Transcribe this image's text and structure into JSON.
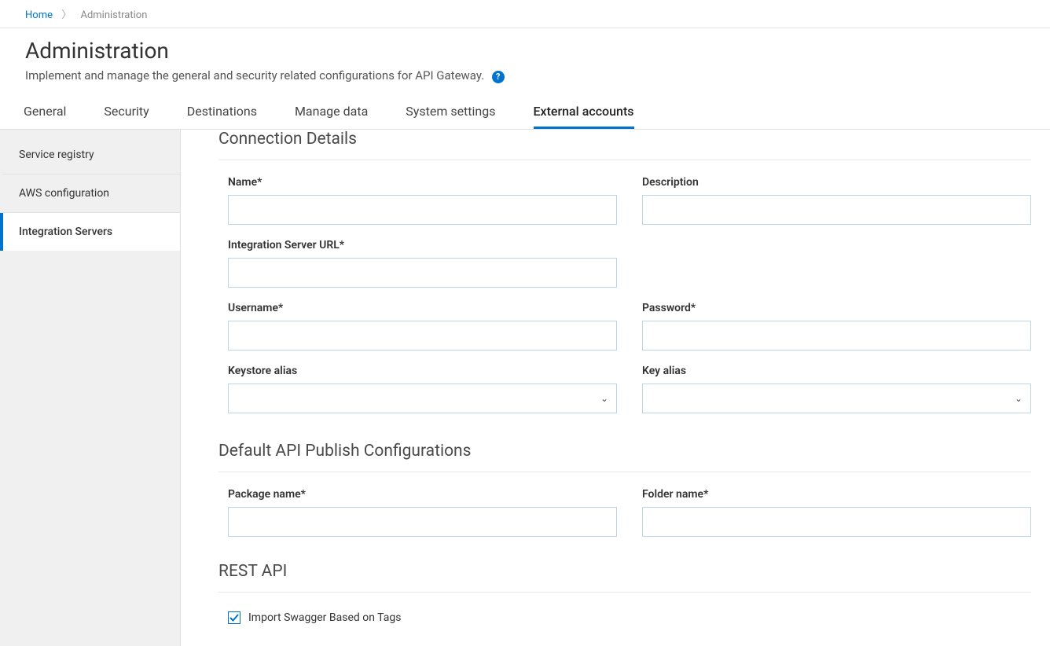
{
  "breadcrumb": {
    "home": "Home",
    "current": "Administration"
  },
  "header": {
    "title": "Administration",
    "subtitle": "Implement and manage the general and security related configurations for API Gateway.",
    "help": "?"
  },
  "tabs": {
    "items": [
      {
        "label": "General"
      },
      {
        "label": "Security"
      },
      {
        "label": "Destinations"
      },
      {
        "label": "Manage data"
      },
      {
        "label": "System settings"
      },
      {
        "label": "External accounts"
      }
    ],
    "activeIndex": 5
  },
  "sidebar": {
    "items": [
      {
        "label": "Service registry"
      },
      {
        "label": "AWS configuration"
      },
      {
        "label": "Integration Servers"
      }
    ],
    "activeIndex": 2
  },
  "sections": {
    "connection": {
      "title": "Connection Details",
      "fields": {
        "name": {
          "label": "Name*",
          "value": ""
        },
        "description": {
          "label": "Description",
          "value": ""
        },
        "isUrl": {
          "label": "Integration Server URL*",
          "value": ""
        },
        "username": {
          "label": "Username*",
          "value": ""
        },
        "password": {
          "label": "Password*",
          "value": ""
        },
        "keystore": {
          "label": "Keystore alias",
          "value": ""
        },
        "keyalias": {
          "label": "Key alias",
          "value": ""
        }
      }
    },
    "publish": {
      "title": "Default API Publish Configurations",
      "fields": {
        "package": {
          "label": "Package name*",
          "value": ""
        },
        "folder": {
          "label": "Folder name*",
          "value": ""
        }
      }
    },
    "rest": {
      "title": "REST API",
      "swaggerCheckbox": {
        "label": "Import Swagger Based on Tags",
        "checked": true
      }
    }
  }
}
